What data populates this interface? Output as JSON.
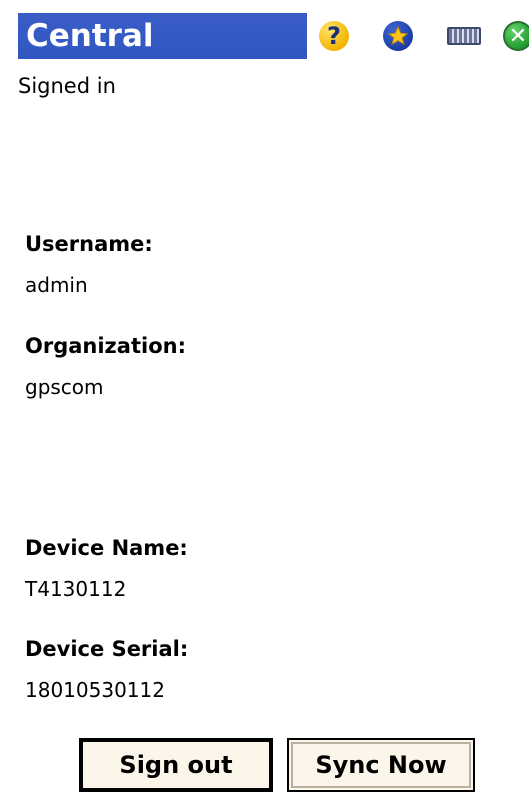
{
  "titlebar": {
    "title": "Central",
    "icons": [
      "help-icon",
      "favorites-icon",
      "keyboard-icon",
      "close-icon"
    ],
    "help_glyph": "?",
    "close_glyph": "✕"
  },
  "status": "Signed in",
  "account": {
    "username_label": "Username:",
    "username_value": "admin",
    "organization_label": "Organization:",
    "organization_value": "gpscom"
  },
  "device": {
    "name_label": "Device Name:",
    "name_value": "T4130112",
    "serial_label": "Device Serial:",
    "serial_value": "18010530112"
  },
  "buttons": {
    "sign_out": "Sign out",
    "sync_now": "Sync Now"
  },
  "colors": {
    "titlebar": "#3157c2",
    "button_bg": "#fbf6e9"
  }
}
